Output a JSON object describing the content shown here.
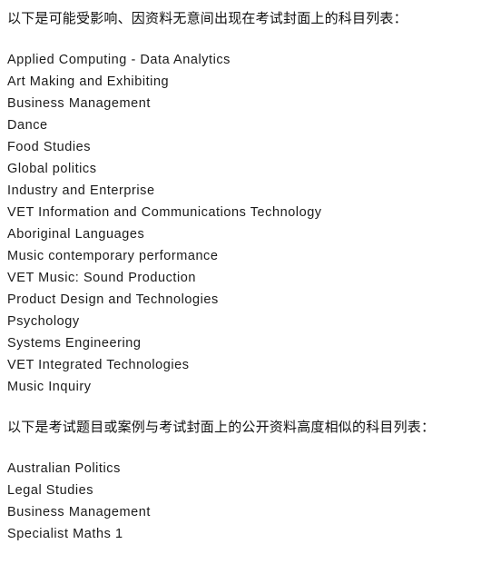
{
  "document": {
    "background_color": "#ffffff",
    "text_color": "#1a1a1a",
    "sections": [
      {
        "heading": "以下是可能受影响、因资料无意间出现在考试封面上的科目列表：",
        "items": [
          "Applied Computing - Data Analytics",
          "Art Making and Exhibiting",
          "Business Management",
          "Dance",
          "Food Studies",
          "Global politics",
          "Industry and Enterprise",
          "VET Information and Communications Technology",
          "Aboriginal Languages",
          "Music contemporary performance",
          "VET Music: Sound Production",
          "Product Design and Technologies",
          "Psychology",
          "Systems Engineering",
          "VET Integrated Technologies",
          "Music Inquiry"
        ]
      },
      {
        "heading": "以下是考试题目或案例与考试封面上的公开资料高度相似的科目列表：",
        "items": [
          "Australian Politics",
          "Legal Studies",
          "Business Management",
          "Specialist Maths 1"
        ]
      }
    ]
  }
}
